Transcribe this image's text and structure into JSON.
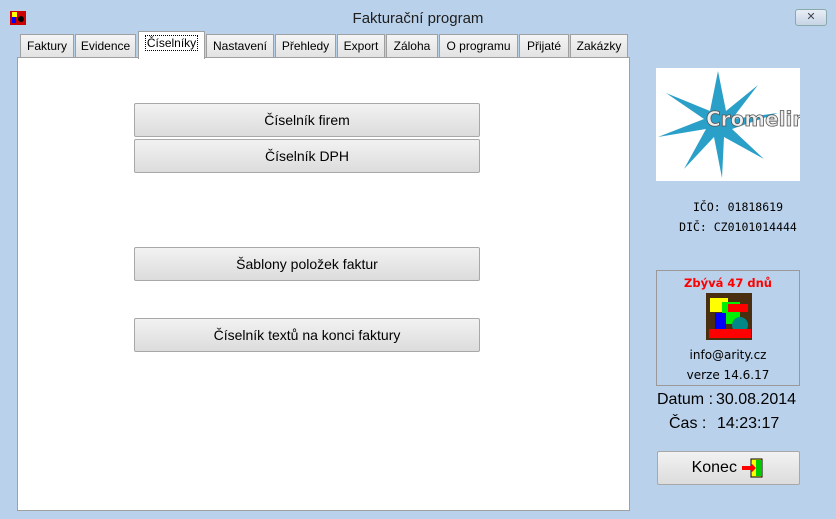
{
  "window": {
    "title": "Fakturační program",
    "close_label": "✕"
  },
  "tabs": [
    {
      "label": "Faktury"
    },
    {
      "label": "Evidence"
    },
    {
      "label": "Číselníky",
      "active": true
    },
    {
      "label": "Nastavení"
    },
    {
      "label": "Přehledy"
    },
    {
      "label": "Export"
    },
    {
      "label": "Záloha"
    },
    {
      "label": "O programu"
    },
    {
      "label": "Přijaté"
    },
    {
      "label": "Zakázky"
    }
  ],
  "main": {
    "buttons": [
      {
        "label": "Číselník firem"
      },
      {
        "label": "Číselník DPH"
      },
      {
        "label": "Šablony položek faktur"
      },
      {
        "label": "Číselník textů na konci faktury"
      }
    ]
  },
  "side": {
    "logo_text": "Cromelin",
    "ico": "IČO: 01818619",
    "dic": "DIČ: CZ0101014444",
    "remaining": "Zbývá 47 dnů",
    "email": "info@arity.cz",
    "version": "verze 14.6.17",
    "date_label": "Datum :",
    "date": "30.08.2014",
    "time_label": "Čas :",
    "time": "14:23:17",
    "exit_label": "Konec"
  }
}
